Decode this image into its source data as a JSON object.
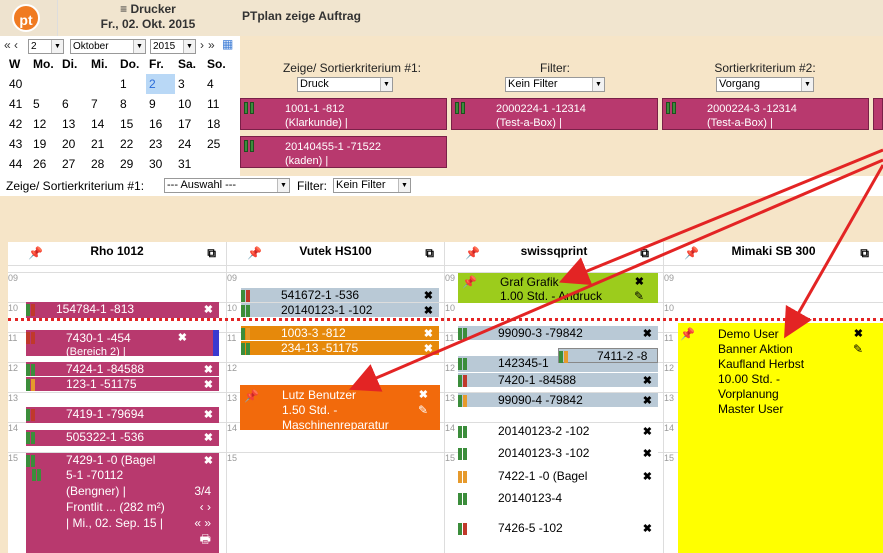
{
  "header": {
    "logo": "pt",
    "printer_label": "Drucker",
    "date": "Fr., 02. Okt. 2015",
    "app_title": "PTplan   zeige Auftrag"
  },
  "calendar": {
    "day_select": "2",
    "month_select": "Oktober",
    "year_select": "2015",
    "weekday_headers": [
      "W",
      "Mo.",
      "Di.",
      "Mi.",
      "Do.",
      "Fr.",
      "Sa.",
      "So."
    ],
    "weeks": [
      [
        "40",
        "",
        "",
        "",
        "1",
        "2",
        "3",
        "4"
      ],
      [
        "41",
        "5",
        "6",
        "7",
        "8",
        "9",
        "10",
        "11"
      ],
      [
        "42",
        "12",
        "13",
        "14",
        "15",
        "16",
        "17",
        "18"
      ],
      [
        "43",
        "19",
        "20",
        "21",
        "22",
        "23",
        "24",
        "25"
      ],
      [
        "44",
        "26",
        "27",
        "28",
        "29",
        "30",
        "31",
        ""
      ]
    ]
  },
  "filters": {
    "sort1_label": "Zeige/ Sortierkriterium #1:",
    "sort1_value": "Druck",
    "filter_label": "Filter:",
    "filter_value": "Kein Filter",
    "sort2_label": "Sortierkriterium #2:",
    "sort2_value": "Vorgang"
  },
  "orders": [
    {
      "line1": "1001-1 -812",
      "line2": "(Klarkunde) |"
    },
    {
      "line1": "2000224-1 -12314",
      "line2": "(Test-a-Box) |"
    },
    {
      "line1": "2000224-3 -12314",
      "line2": "(Test-a-Box) |"
    },
    {
      "line1": "20140455-1 -71522",
      "line2": "(kaden) |"
    }
  ],
  "bottom_filter": {
    "sort_label": "Zeige/ Sortierkriterium #1:",
    "sort_value": "--- Auswahl ---",
    "filter_label": "Filter:",
    "filter_value": "Kein Filter"
  },
  "machines": [
    "Rho 1012",
    "Vutek HS100",
    "swissqprint",
    "Mimaki SB 300"
  ],
  "hours": [
    "09",
    "10",
    "11",
    "12",
    "13",
    "14",
    "15"
  ],
  "col1": {
    "a": "154784-1 -813",
    "b1": "7430-1 -454",
    "b2": "(Bereich 2) |",
    "c": "7424-1 -84588",
    "d": "123-1 -51175",
    "e": "7419-1 -79694",
    "f": "505322-1 -536",
    "g": "7429-1 -0 (Bagel",
    "h1": "5-1 -70112",
    "h2": "(Bengner) |",
    "h3": "Frontlit ... (282 m²)",
    "h4": "| Mi., 02. Sep. 15 |",
    "page": "3/4",
    "nav": "‹ ›",
    "nav2": "« »"
  },
  "col2": {
    "a": "541672-1 -536",
    "b": "20140123-1 -102",
    "c": "1003-3 -812",
    "d": "234-13 -51175",
    "note1": "Lutz Benutzer",
    "note2": "1.50 Std. -",
    "note3": "Maschinenreparatur"
  },
  "col3": {
    "note1": "Graf Grafik",
    "note2": "1.00 Std. - Andruck",
    "a": "99090-3 -79842",
    "b": "142345-1",
    "c": "7411-2 -8",
    "d": "7420-1 -84588",
    "e": "99090-4 -79842",
    "f": "20140123-2 -102",
    "g": "20140123-3 -102",
    "h": "7422-1 -0 (Bagel",
    "i": "20140123-4",
    "j": "7426-5 -102"
  },
  "col4": {
    "l1": "Demo User",
    "l2": "Banner Aktion",
    "l3": "Kaufland Herbst",
    "l4": "10.00 Std. -",
    "l5": "Vorplanung",
    "l6": "Master User"
  },
  "colors": {
    "accent": "#b8396e",
    "orange": "#e6890b",
    "note_green": "#9ccc1c",
    "note_yellow": "#ffff00",
    "arrow": "#e32424"
  }
}
